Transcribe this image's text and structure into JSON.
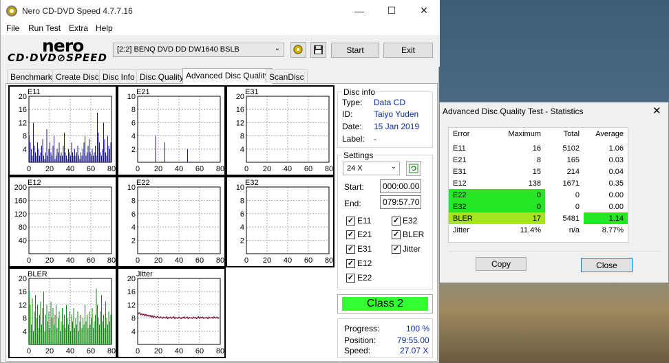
{
  "window": {
    "title": "Nero CD-DVD Speed 4.7.7.16",
    "minimize": "—",
    "maximize": "☐",
    "close": "✕"
  },
  "menu": [
    "File",
    "Run Test",
    "Extra",
    "Help"
  ],
  "logo": {
    "top": "nero",
    "bottom": "CD·DVD⊘SPEED"
  },
  "toolbar": {
    "drive": "[2:2]   BENQ DVD DD DW1640 BSLB",
    "start_label": "Start",
    "exit_label": "Exit"
  },
  "tabs": [
    "Benchmark",
    "Create Disc",
    "Disc Info",
    "Disc Quality",
    "Advanced Disc Quality",
    "ScanDisc"
  ],
  "disc_info": {
    "heading": "Disc info",
    "type_label": "Type:",
    "type": "Data CD",
    "id_label": "ID:",
    "id": "Taiyo Yuden",
    "date_label": "Date:",
    "date": "15 Jan 2019",
    "label_label": "Label:",
    "label": "-"
  },
  "settings": {
    "heading": "Settings",
    "speed": "24 X",
    "start_label": "Start:",
    "start": "000:00.00",
    "end_label": "End:",
    "end": "079:57.70",
    "checks": [
      {
        "label": "E11",
        "checked": true
      },
      {
        "label": "E32",
        "checked": true
      },
      {
        "label": "E21",
        "checked": true
      },
      {
        "label": "BLER",
        "checked": true
      },
      {
        "label": "E31",
        "checked": true
      },
      {
        "label": "Jitter",
        "checked": true
      },
      {
        "label": "E12",
        "checked": true
      },
      {
        "label": "E22",
        "checked": true
      }
    ]
  },
  "class_label": "Class 2",
  "progress": {
    "progress_label": "Progress:",
    "progress": "100 %",
    "position_label": "Position:",
    "position": "79:55.00",
    "speed_label": "Speed:",
    "speed": "27.07 X"
  },
  "colors": {
    "navy": "#1a1a80",
    "purple": "#6a0f8a",
    "green": "#138a13",
    "maroon": "#7a0f3c",
    "class_green": "#33ff33"
  },
  "chart_data": [
    {
      "type": "bar",
      "name": "E11",
      "ylim": [
        0,
        20
      ],
      "yticks": [
        4,
        8,
        12,
        16,
        20
      ],
      "xticks": [
        0,
        20,
        40,
        60,
        80
      ],
      "xlim": [
        0,
        80
      ],
      "color": "#1a1a80",
      "values": [
        8,
        6,
        4,
        2,
        12,
        5,
        3,
        2,
        6,
        4,
        2,
        3,
        5,
        7,
        2,
        1,
        3,
        10,
        2,
        4,
        6,
        3,
        2,
        5,
        8,
        1,
        2,
        4,
        3,
        6,
        2,
        3,
        2,
        5,
        9,
        3,
        2,
        1,
        4,
        3,
        2,
        6,
        3,
        2,
        4,
        2,
        3,
        5,
        2,
        1,
        3,
        2,
        4,
        6,
        8,
        2,
        3,
        5,
        7,
        3,
        2,
        4,
        2,
        3,
        5,
        2,
        15,
        9,
        6,
        3,
        2,
        4,
        12,
        7,
        3,
        2,
        8,
        5,
        4,
        6
      ]
    },
    {
      "type": "bar",
      "name": "E21",
      "ylim": [
        0,
        10
      ],
      "yticks": [
        2,
        4,
        6,
        8,
        10
      ],
      "xticks": [
        0,
        20,
        40,
        60,
        80
      ],
      "xlim": [
        0,
        80
      ],
      "color": "#1a1a80",
      "values": [
        0,
        0,
        0,
        0,
        0,
        0,
        0,
        0,
        0,
        0,
        0,
        0,
        0,
        0,
        0,
        0,
        0,
        4,
        0,
        0,
        0,
        0,
        0,
        0,
        0,
        0,
        3,
        0,
        0,
        0,
        0,
        0,
        0,
        0,
        0,
        0,
        0,
        0,
        0,
        0,
        0,
        0,
        0,
        0,
        0,
        0,
        0,
        0,
        2,
        0,
        0,
        0,
        0,
        0,
        0,
        0,
        0,
        0,
        0,
        0,
        0,
        0,
        0,
        0,
        0,
        0,
        0,
        0,
        0,
        0,
        0,
        0,
        0,
        0,
        0,
        0,
        0,
        0,
        0,
        0
      ]
    },
    {
      "type": "bar",
      "name": "E31",
      "ylim": [
        0,
        20
      ],
      "yticks": [
        4,
        8,
        12,
        16,
        20
      ],
      "xticks": [
        0,
        20,
        40,
        60,
        80
      ],
      "xlim": [
        0,
        80
      ],
      "color": "#1a1a80",
      "values": [
        0,
        0,
        0,
        0,
        0,
        0,
        0,
        0,
        0,
        0,
        0,
        0,
        0,
        0,
        0,
        0,
        0,
        0,
        0,
        0,
        0,
        0,
        0,
        0,
        0,
        0,
        0,
        0,
        0,
        0,
        0,
        0,
        0,
        0,
        0,
        0,
        0,
        0,
        0,
        0,
        0,
        0,
        0,
        0,
        0,
        0,
        0,
        0,
        0,
        0,
        0,
        0,
        0,
        0,
        0,
        0,
        0,
        0,
        0,
        0,
        0,
        0,
        0,
        0,
        0,
        0,
        0,
        0,
        0,
        0,
        0,
        0,
        0,
        0,
        0,
        0,
        0,
        0,
        0,
        0
      ]
    },
    {
      "type": "bar",
      "name": "E12",
      "ylim": [
        0,
        200
      ],
      "yticks": [
        40,
        80,
        120,
        160,
        200
      ],
      "xticks": [
        0,
        20,
        40,
        60,
        80
      ],
      "xlim": [
        0,
        80
      ],
      "color": "#6a0f8a",
      "values": [
        0,
        0,
        0,
        0,
        0,
        0,
        0,
        0,
        0,
        0,
        0,
        0,
        0,
        0,
        0,
        0,
        0,
        0,
        0,
        0,
        0,
        0,
        0,
        0,
        0,
        0,
        0,
        0,
        0,
        0,
        0,
        0,
        0,
        0,
        0,
        0,
        0,
        0,
        0,
        0,
        0,
        0,
        0,
        0,
        0,
        0,
        0,
        0,
        0,
        0,
        0,
        0,
        0,
        0,
        0,
        0,
        0,
        0,
        0,
        0,
        0,
        0,
        0,
        0,
        0,
        0,
        0,
        0,
        0,
        0,
        0,
        0,
        0,
        0,
        0,
        0,
        0,
        0,
        0,
        0
      ]
    },
    {
      "type": "bar",
      "name": "E22",
      "ylim": [
        0,
        10
      ],
      "yticks": [
        2,
        4,
        6,
        8,
        10
      ],
      "xticks": [
        0,
        20,
        40,
        60,
        80
      ],
      "xlim": [
        0,
        80
      ],
      "color": "#1a1a80",
      "values": []
    },
    {
      "type": "bar",
      "name": "E32",
      "ylim": [
        0,
        10
      ],
      "yticks": [
        2,
        4,
        6,
        8,
        10
      ],
      "xticks": [
        0,
        20,
        40,
        60,
        80
      ],
      "xlim": [
        0,
        80
      ],
      "color": "#1a1a80",
      "values": []
    },
    {
      "type": "bar",
      "name": "BLER",
      "ylim": [
        0,
        20
      ],
      "yticks": [
        4,
        8,
        12,
        16,
        20
      ],
      "xticks": [
        0,
        20,
        40,
        60,
        80
      ],
      "xlim": [
        0,
        80
      ],
      "color": "#138a13",
      "values": [
        16,
        12,
        6,
        14,
        4,
        10,
        15,
        8,
        12,
        5,
        9,
        13,
        6,
        11,
        16,
        4,
        9,
        12,
        7,
        10,
        5,
        13,
        8,
        11,
        6,
        9,
        12,
        5,
        8,
        10,
        4,
        7,
        11,
        6,
        9,
        5,
        12,
        8,
        6,
        10,
        4,
        9,
        7,
        11,
        5,
        8,
        6,
        10,
        4,
        7,
        9,
        5,
        8,
        6,
        12,
        7,
        9,
        5,
        10,
        6,
        8,
        11,
        5,
        7,
        9,
        17,
        12,
        8,
        6,
        10,
        15,
        7,
        9,
        5,
        13,
        8,
        6,
        10,
        7,
        9
      ]
    },
    {
      "type": "line",
      "name": "Jitter",
      "ylim": [
        0,
        20
      ],
      "yticks": [
        4,
        8,
        12,
        16,
        20
      ],
      "xticks": [
        0,
        20,
        40,
        60,
        80
      ],
      "xlim": [
        0,
        80
      ],
      "color": "#7a0f3c",
      "values": [
        9.8,
        9.4,
        9.6,
        9.0,
        9.3,
        8.9,
        9.2,
        8.7,
        9.1,
        8.6,
        8.9,
        8.5,
        8.8,
        8.3,
        8.7,
        8.2,
        8.6,
        8.4,
        8.1,
        8.5,
        8.3,
        8.0,
        8.4,
        8.2,
        7.9,
        8.3,
        8.1,
        8.0,
        8.4,
        7.8,
        8.2,
        8.0,
        8.3,
        7.9,
        8.1,
        8.4,
        7.8,
        8.2,
        8.0,
        7.9,
        8.3,
        8.1,
        7.8,
        8.2,
        8.0,
        8.4,
        7.9,
        8.1,
        8.3,
        7.8,
        8.2,
        8.0,
        8.1,
        7.9,
        8.3,
        8.0,
        8.2,
        7.8,
        8.1,
        8.4,
        7.9,
        8.2,
        8.0,
        8.3,
        7.9,
        8.1,
        8.0,
        8.2,
        7.8,
        8.3,
        8.1,
        8.0,
        8.2,
        7.9,
        8.4,
        8.0,
        8.1,
        8.3,
        7.9,
        8.2
      ]
    }
  ],
  "stats_dialog": {
    "title": "Advanced Disc Quality Test - Statistics",
    "close": "✕",
    "headers": [
      "Error",
      "Maximum",
      "Total",
      "Average"
    ],
    "rows": [
      {
        "name": "E11",
        "max": "16",
        "total": "5102",
        "avg": "1.06",
        "hl": ""
      },
      {
        "name": "E21",
        "max": "8",
        "total": "165",
        "avg": "0.03",
        "hl": ""
      },
      {
        "name": "E31",
        "max": "15",
        "total": "214",
        "avg": "0.04",
        "hl": ""
      },
      {
        "name": "E12",
        "max": "138",
        "total": "1671",
        "avg": "0.35",
        "hl": ""
      },
      {
        "name": "E22",
        "max": "0",
        "total": "0",
        "avg": "0.00",
        "hl": "green"
      },
      {
        "name": "E32",
        "max": "0",
        "total": "0",
        "avg": "0.00",
        "hl": "green"
      },
      {
        "name": "BLER",
        "max": "17",
        "total": "5481",
        "avg": "1.14",
        "hl": "bler"
      },
      {
        "name": "Jitter",
        "max": "11.4%",
        "total": "n/a",
        "avg": "8.77%",
        "hl": ""
      }
    ],
    "copy_label": "Copy",
    "close_label": "Close"
  }
}
